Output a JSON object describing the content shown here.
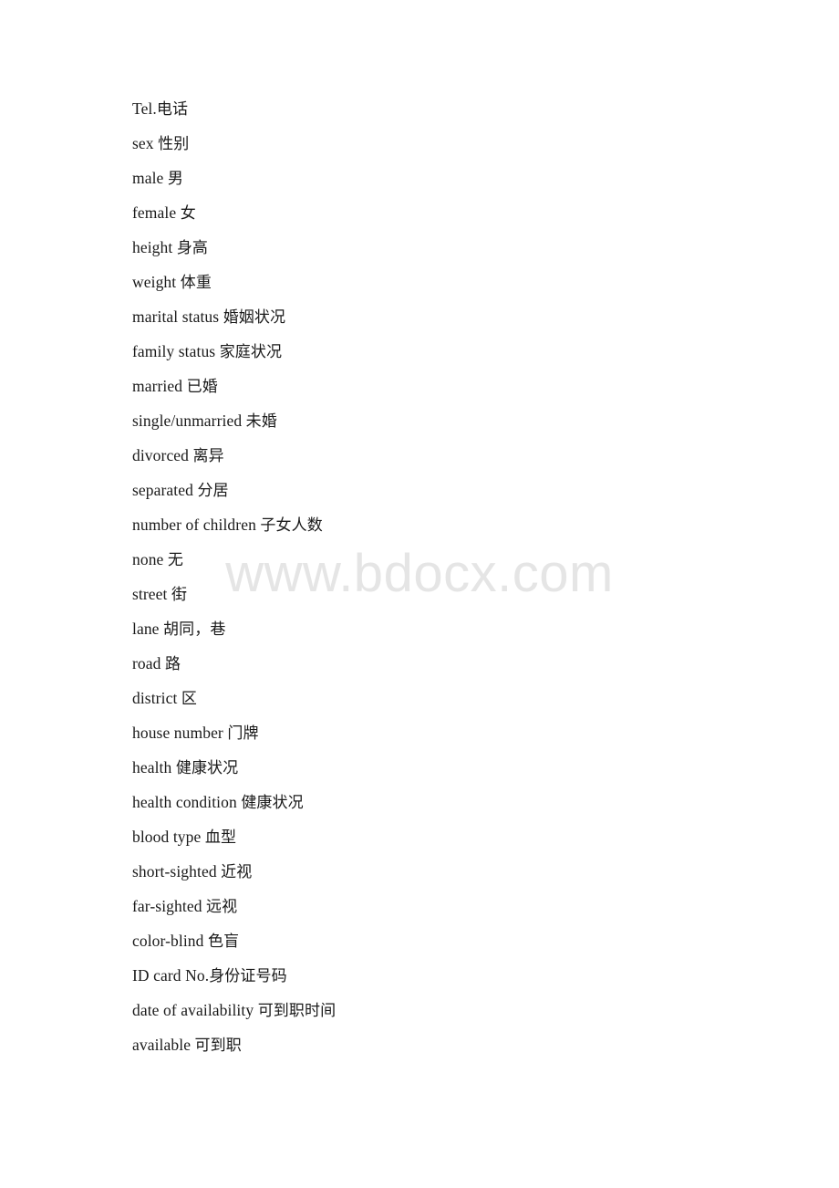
{
  "document": {
    "page_background": "#ffffff",
    "text_color": "#1a1a1a",
    "watermark": {
      "text": "www.bdocx.com",
      "color": "#e5e5e5"
    },
    "lines": [
      {
        "text": "Tel.电话"
      },
      {
        "text": "sex 性别"
      },
      {
        "text": "male 男"
      },
      {
        "text": "female 女"
      },
      {
        "text": "height 身高"
      },
      {
        "text": "weight 体重"
      },
      {
        "text": "marital status 婚姻状况"
      },
      {
        "text": "family status 家庭状况"
      },
      {
        "text": "married 已婚"
      },
      {
        "text": "single/unmarried 未婚"
      },
      {
        "text": "divorced 离异"
      },
      {
        "text": "separated 分居"
      },
      {
        "text": "number of children 子女人数"
      },
      {
        "text": "none 无"
      },
      {
        "text": "street 街"
      },
      {
        "text": "lane 胡同，巷"
      },
      {
        "text": "road 路"
      },
      {
        "text": "district 区"
      },
      {
        "text": "house number 门牌"
      },
      {
        "text": "health 健康状况"
      },
      {
        "text": "health condition 健康状况"
      },
      {
        "text": "blood type 血型"
      },
      {
        "text": "short-sighted 近视"
      },
      {
        "text": "far-sighted 远视"
      },
      {
        "text": "color-blind 色盲"
      },
      {
        "text": "ID card No.身份证号码"
      },
      {
        "text": "date of availability 可到职时间"
      },
      {
        "text": "available 可到职"
      }
    ]
  }
}
